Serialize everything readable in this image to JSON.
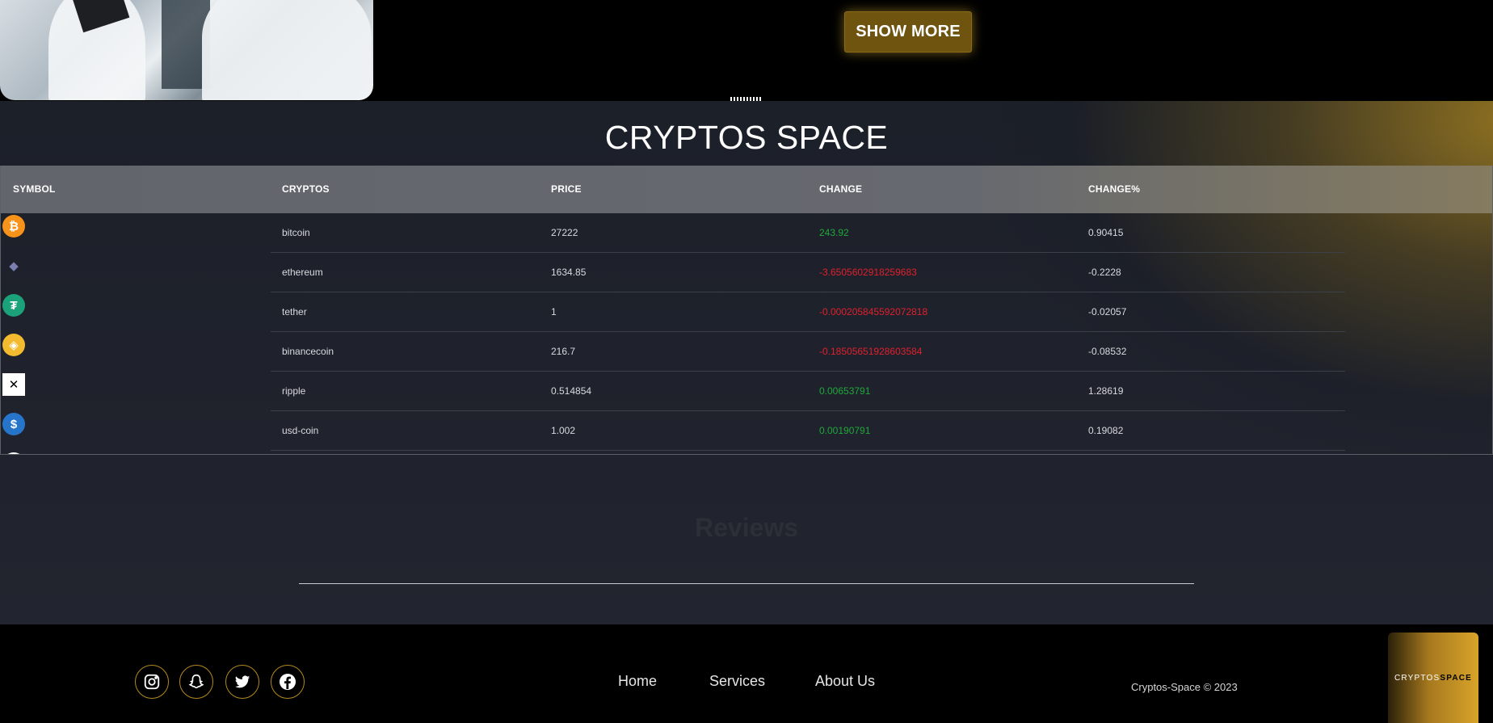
{
  "hero": {
    "show_more_label": "SHOW MORE"
  },
  "main": {
    "title": "CRYPTOS SPACE",
    "table": {
      "headers": [
        "SYMBOL",
        "CRYPTOS",
        "PRICE",
        "CHANGE",
        "CHANGE%"
      ],
      "rows": [
        {
          "icon": "bitcoin-icon",
          "color": "#f7931a",
          "glyph": "₿",
          "name": "bitcoin",
          "price": "27222",
          "change": "243.92",
          "trend": "up",
          "change_pct": "0.90415"
        },
        {
          "icon": "ethereum-icon",
          "color": "#1e2029",
          "glyph": "◆",
          "name": "ethereum",
          "price": "1634.85",
          "change": "-3.6505602918259683",
          "trend": "down",
          "change_pct": "-0.2228"
        },
        {
          "icon": "tether-icon",
          "color": "#1ba27a",
          "glyph": "₮",
          "name": "tether",
          "price": "1",
          "change": "-0.000205845592072818",
          "trend": "down",
          "change_pct": "-0.02057"
        },
        {
          "icon": "binancecoin-icon",
          "color": "#f3ba2f",
          "glyph": "◈",
          "name": "binancecoin",
          "price": "216.7",
          "change": "-0.18505651928603584",
          "trend": "down",
          "change_pct": "-0.08532"
        },
        {
          "icon": "ripple-icon",
          "color": "#ffffff",
          "glyph": "✕",
          "name": "ripple",
          "price": "0.514854",
          "change": "0.00653791",
          "trend": "up",
          "change_pct": "1.28619"
        },
        {
          "icon": "usd-coin-icon",
          "color": "#2775ca",
          "glyph": "$",
          "name": "usd-coin",
          "price": "1.002",
          "change": "0.00190791",
          "trend": "up",
          "change_pct": "0.19082"
        }
      ]
    },
    "reviews_title": "Reviews"
  },
  "footer": {
    "social": [
      "instagram-icon",
      "snapchat-icon",
      "twitter-icon",
      "facebook-icon"
    ],
    "nav": [
      "Home",
      "Services",
      "About Us"
    ],
    "copyright": "Cryptos-Space © 2023",
    "logo_part1": "CRYPTOS",
    "logo_part2": "SPACE"
  }
}
